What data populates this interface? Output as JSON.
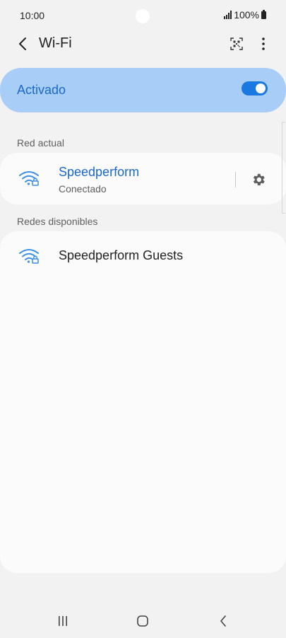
{
  "status_bar": {
    "time": "10:00",
    "battery_text": "100%",
    "icons": [
      "signal-icon",
      "battery-icon"
    ]
  },
  "header": {
    "title": "Wi-Fi",
    "icons": [
      "back-icon",
      "qr-code-icon",
      "more-options-icon"
    ]
  },
  "master_switch": {
    "label": "Activado",
    "enabled": true
  },
  "current_network": {
    "section_label": "Red actual",
    "name": "Speedperform",
    "status": "Conectado",
    "icons": [
      "wifi-secured-icon",
      "gear-icon"
    ]
  },
  "available_networks": {
    "section_label": "Redes disponibles",
    "items": [
      {
        "name": "Speedperform Guests",
        "icon": "wifi-secured-icon"
      }
    ]
  },
  "colors": {
    "accent": "#1a79e0",
    "accent_text": "#1a69c9",
    "master_bg": "#a8cdf6",
    "page_bg": "#f2f2f2",
    "card_bg": "#fbfbfb"
  },
  "nav_bar": {
    "icons": [
      "recent-apps-icon",
      "home-icon",
      "back-nav-icon"
    ]
  }
}
